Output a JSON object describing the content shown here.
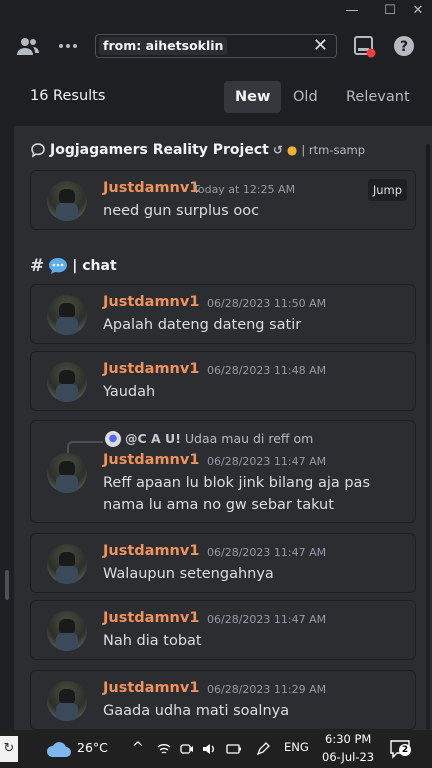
{
  "window": {
    "minimize_icon": "minimize-icon",
    "maximize_icon": "maximize-icon",
    "close_icon": "close-icon"
  },
  "toolbar": {
    "members_icon": "members-icon",
    "more_icon": "more-icon",
    "search_value": "from: aihetsoklin",
    "clear_icon": "clear-icon",
    "inbox_icon": "inbox-icon",
    "help_icon": "help-icon"
  },
  "results": {
    "count": "16 Results",
    "tabs": [
      "New",
      "Old",
      "Relevant"
    ],
    "active_tab": "New"
  },
  "groups": [
    {
      "channel": "Jogjagamers Reality Project",
      "channel_sub": "| rtm-samp",
      "messages": [
        {
          "user": "Justdamnv1",
          "time": "Today at 12:25 AM",
          "text": "need gun surplus ooc",
          "jump": "Jump"
        }
      ]
    },
    {
      "channel": "| chat",
      "messages": [
        {
          "user": "Justdamnv1",
          "time": "06/28/2023 11:50 AM",
          "text": "Apalah dateng dateng satir"
        },
        {
          "user": "Justdamnv1",
          "time": "06/28/2023 11:48 AM",
          "text": "Yaudah"
        },
        {
          "user": "Justdamnv1",
          "time": "06/28/2023 11:47 AM",
          "text": "Reff apaan lu blok jink bilang aja pas nama lu ama no gw sebar takut",
          "reply_user": "@C A U!",
          "reply_text": "Udaa mau di reff om"
        },
        {
          "user": "Justdamnv1",
          "time": "06/28/2023 11:47 AM",
          "text": "Walaupun setengahnya"
        },
        {
          "user": "Justdamnv1",
          "time": "06/28/2023 11:47 AM",
          "text": "Nah dia tobat"
        },
        {
          "user": "Justdamnv1",
          "time": "06/28/2023 11:29 AM",
          "text": "Gaada udha mati soalnya"
        }
      ]
    }
  ],
  "taskbar": {
    "weather": "26°C",
    "language": "ENG",
    "time": "6:30 PM",
    "date": "06-Jul-23",
    "notifications": "2"
  },
  "colors": {
    "username": "#f0925b",
    "panel": "#2b2d31",
    "background": "#1e1f22",
    "accent": "#5865f2"
  }
}
